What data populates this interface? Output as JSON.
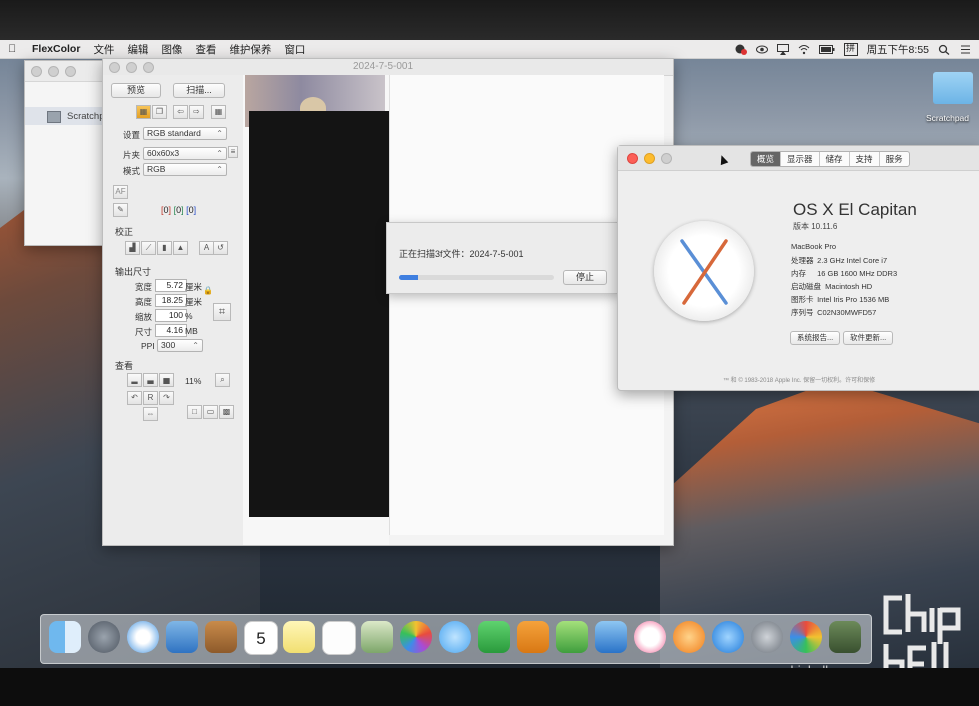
{
  "menubar": {
    "app_name": "FlexColor",
    "items": [
      "文件",
      "编辑",
      "图像",
      "查看",
      "维护保养",
      "窗口"
    ],
    "clock": "周五下午8:55"
  },
  "scratch_window": {
    "item_label": "Scratchpad"
  },
  "flexcolor_window": {
    "title": "2024-7-5-001",
    "preview_button": "预览",
    "scan_button": "扫描...",
    "settings_label": "设置",
    "settings_value": "RGB standard",
    "holder_label": "片夹",
    "holder_value": "60x60x3",
    "mode_label": "模式",
    "mode_value": "RGB",
    "af_label": "AF",
    "channel_values": [
      "0",
      "0",
      "0"
    ],
    "correction_section": "校正",
    "output_section": "输出尺寸",
    "width_label": "宽度",
    "width_value": "5.72",
    "width_unit": "厘米",
    "height_label": "高度",
    "height_value": "18.25",
    "height_unit": "厘米",
    "scale_label": "缩放",
    "scale_value": "100",
    "scale_unit": "%",
    "size_label": "尺寸",
    "size_value": "4.16",
    "size_unit": "MB",
    "ppi_label": "PPI",
    "ppi_value": "300",
    "view_section": "查看",
    "zoom_value": "11%",
    "rotate_reset": "R"
  },
  "progress_sheet": {
    "message": "正在扫描3f文件：2024-7-5-001",
    "stop_button": "停止",
    "progress": 0.12
  },
  "about_window": {
    "tabs": [
      "概览",
      "显示器",
      "储存",
      "支持",
      "服务"
    ],
    "active_tab": 0,
    "os_name": "OS X El Capitan",
    "version": "版本 10.11.6",
    "model": "MacBook Pro",
    "specs": [
      {
        "label": "处理器",
        "value": "2.3 GHz Intel Core i7"
      },
      {
        "label": "内存",
        "value": "16 GB 1600 MHz DDR3"
      },
      {
        "label": "启动磁盘",
        "value": "Macintosh HD"
      },
      {
        "label": "图形卡",
        "value": "Intel Iris Pro 1536 MB"
      },
      {
        "label": "序列号",
        "value": "C02N30MWFD57"
      }
    ],
    "report_button": "系统报告...",
    "update_button": "软件更新...",
    "copyright": "™ 和 © 1983-2018 Apple Inc. 保留一切权利。许可和保修"
  },
  "desktop": {
    "folder_label": "Scratchpad"
  },
  "dock": {
    "icons": [
      "finder-icon",
      "launchpad-icon",
      "safari-icon",
      "mail-icon",
      "contacts-icon",
      "calendar-icon",
      "notes-icon",
      "reminders-icon",
      "preview-icon",
      "photos-icon",
      "messages-icon",
      "facetime-icon",
      "pages-icon",
      "numbers-icon",
      "keynote-icon",
      "itunes-icon",
      "ibooks-icon",
      "appstore-icon",
      "system-preferences-icon",
      "browser-icon",
      "other-app-icon",
      "trash-icon"
    ],
    "calendar_day": "5"
  },
  "watermark": {
    "text": "www.chiphell.com",
    "logo": "chip hell"
  },
  "colors": {
    "progress": "#3f7fe0",
    "close": "#fc5f57",
    "minimize": "#fdbc2e",
    "zoom": "#34c84a",
    "channel_red": "#c0392b",
    "channel_green": "#2e8b57",
    "channel_blue": "#2a4fc9"
  }
}
